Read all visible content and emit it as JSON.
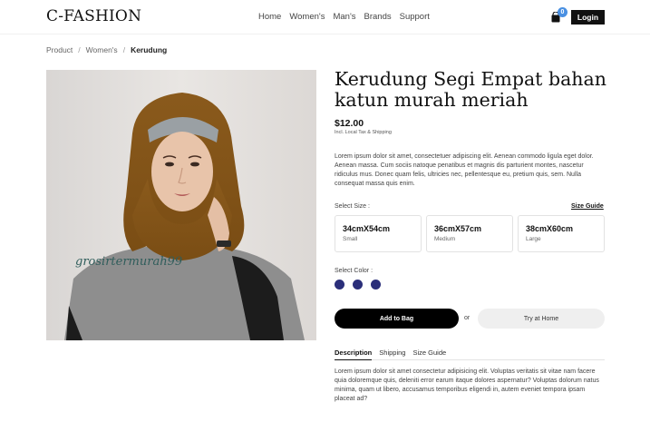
{
  "header": {
    "logo": "C-FASHION",
    "nav": [
      "Home",
      "Women's",
      "Man's",
      "Brands",
      "Support"
    ],
    "bag_count": "0",
    "login_label": "Login"
  },
  "breadcrumb": [
    "Product",
    "Women's",
    "Kerudung"
  ],
  "product": {
    "image_watermark": "grosirtermurah99",
    "title": "Kerudung Segi Empat bahan katun murah meriah",
    "price": "$12.00",
    "tax_note": "Incl. Local Tax & Shipping",
    "description": "Lorem ipsum dolor sit amet, consectetuer adipiscing elit. Aenean commodo ligula eget dolor. Aenean massa. Cum sociis natoque penatibus et magnis dis parturient montes, nascetur ridiculus mus. Donec quam felis, ultricies nec, pellentesque eu, pretium quis, sem. Nulla consequat massa quis enim.",
    "size_label": "Select Size :",
    "size_guide_label": "Size Guide",
    "sizes": [
      {
        "name": "34cmX54cm",
        "sub": "Small"
      },
      {
        "name": "36cmX57cm",
        "sub": "Medium"
      },
      {
        "name": "38cmX60cm",
        "sub": "Large"
      }
    ],
    "color_label": "Select Color :",
    "colors": [
      "#2b2f7a",
      "#2b2f7a",
      "#2b2f7a"
    ],
    "add_to_bag_label": "Add to Bag",
    "or_label": "or",
    "try_home_label": "Try at Home"
  },
  "tabs": {
    "items": [
      "Description",
      "Shipping",
      "Size Guide"
    ],
    "active": "Description",
    "content": "Lorem ipsum dolor sit amet consectetur adipisicing elit. Voluptas veritatis sit vitae nam facere quia doloremque quis, deleniti error earum itaque dolores aspernatur? Voluptas dolorum natus minima, quam ut libero, accusamus temporibus eligendi in, autem eveniet tempora ipsam placeat ad?"
  }
}
